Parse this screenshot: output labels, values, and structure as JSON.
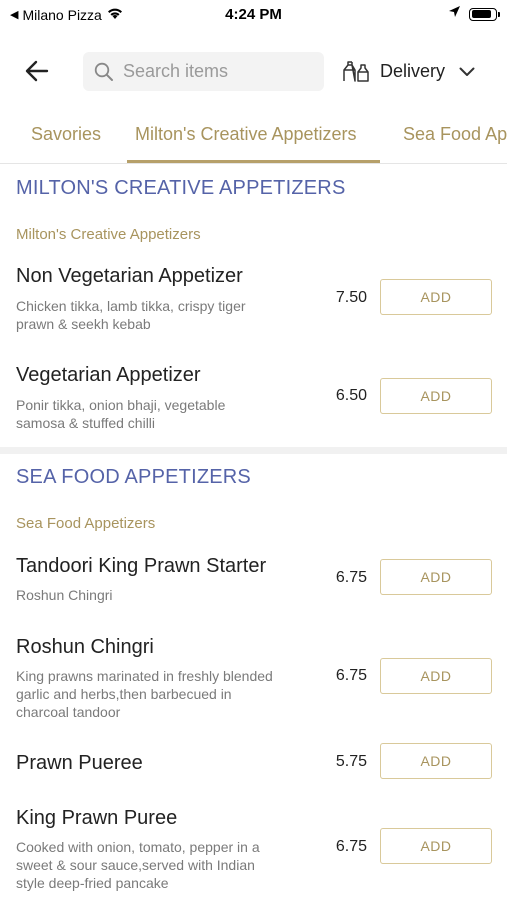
{
  "status_bar": {
    "back_app": "Milano Pizza",
    "time": "4:24 PM",
    "battery_level": 0.85
  },
  "header": {
    "search_placeholder": "Search items",
    "delivery_label": "Delivery"
  },
  "tabs": [
    {
      "label": "Savories",
      "active": false
    },
    {
      "label": "Milton's Creative Appetizers",
      "active": true
    },
    {
      "label": "Sea Food Appetizers",
      "active": false
    }
  ],
  "sections": [
    {
      "title": "MILTON'S CREATIVE APPETIZERS",
      "subtitle": "Milton's Creative Appetizers",
      "items": [
        {
          "name": "Non Vegetarian Appetizer",
          "desc_lines": [
            "Chicken tikka, lamb tikka, crispy tiger",
            "prawn & seekh kebab"
          ],
          "price": "7.50",
          "add_label": "ADD"
        },
        {
          "name": "Vegetarian Appetizer",
          "desc_lines": [
            "Ponir tikka, onion bhaji, vegetable",
            "samosa & stuffed chilli"
          ],
          "price": "6.50",
          "add_label": "ADD"
        }
      ]
    },
    {
      "title": "SEA FOOD APPETIZERS",
      "subtitle": "Sea Food Appetizers",
      "items": [
        {
          "name": "Tandoori King Prawn Starter",
          "desc_lines": [
            "Roshun Chingri"
          ],
          "price": "6.75",
          "add_label": "ADD"
        },
        {
          "name": "Roshun Chingri",
          "desc_lines": [
            "King prawns marinated in freshly blended",
            "garlic and herbs,then barbecued in",
            "charcoal tandoor"
          ],
          "price": "6.75",
          "add_label": "ADD"
        },
        {
          "name": "Prawn Pueree",
          "desc_lines": [],
          "price": "5.75",
          "add_label": "ADD"
        },
        {
          "name": "King Prawn Puree",
          "desc_lines": [
            "Cooked with onion, tomato, pepper in a",
            "sweet & sour sauce,served with Indian",
            "style deep-fried pancake"
          ],
          "price": "6.75",
          "add_label": "ADD"
        }
      ]
    }
  ],
  "colors": {
    "accent_gold": "#a8945e",
    "section_blue": "#5563a8",
    "button_border": "#d9c99a"
  }
}
